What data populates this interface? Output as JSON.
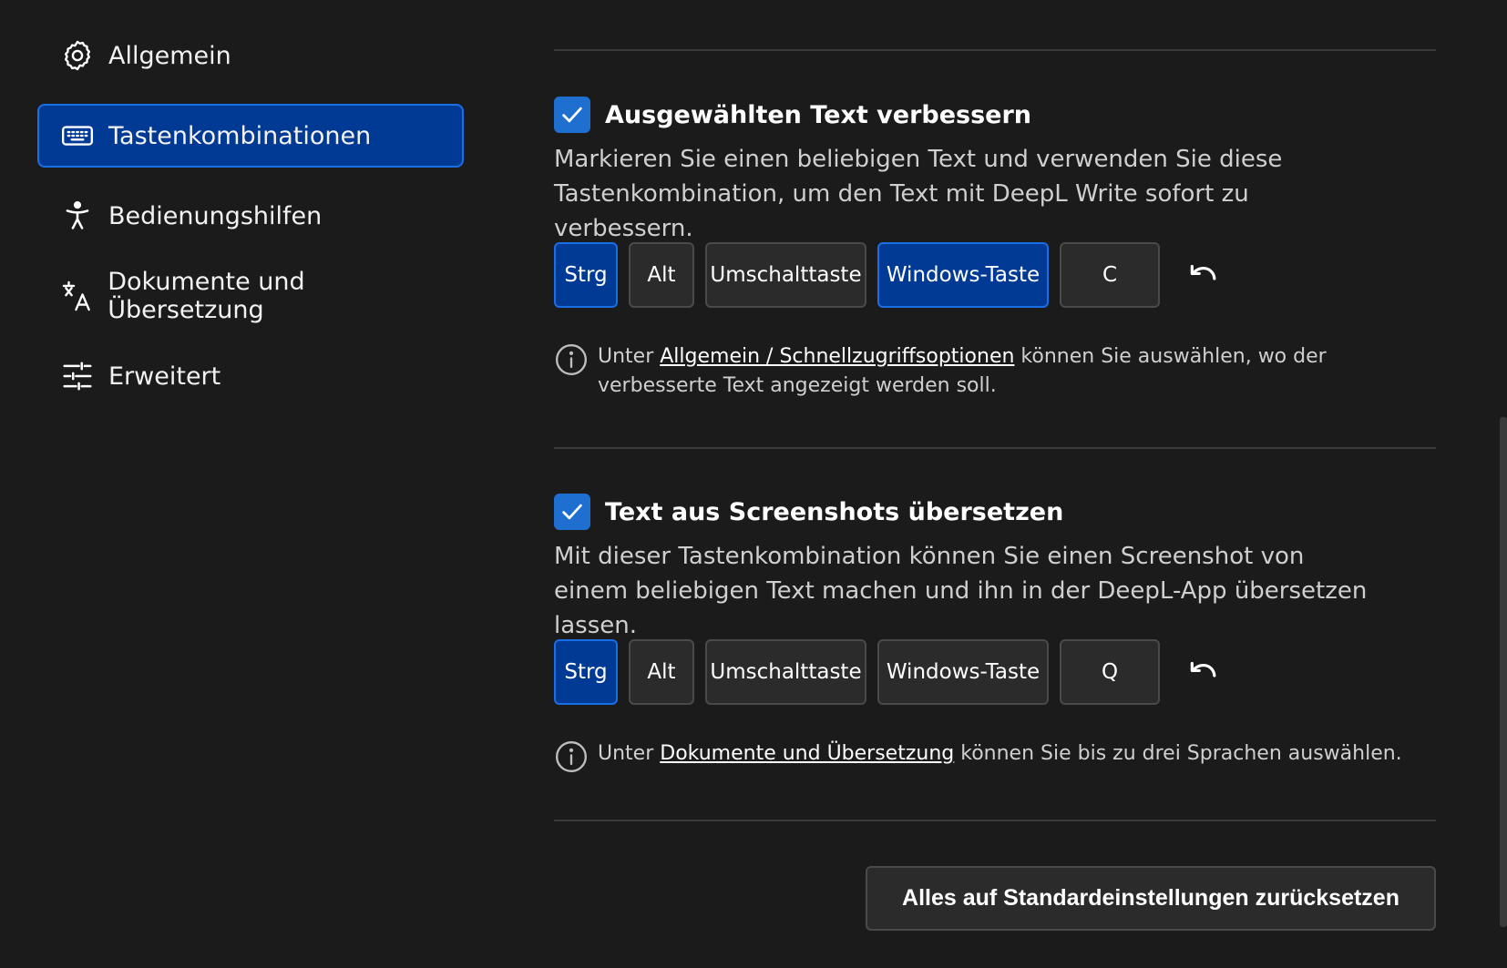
{
  "sidebar": {
    "items": [
      {
        "label": "Allgemein",
        "icon": "gear-icon",
        "active": false
      },
      {
        "label": "Tastenkombinationen",
        "icon": "keyboard-icon",
        "active": true
      },
      {
        "label": "Bedienungshilfen",
        "icon": "accessibility-icon",
        "active": false
      },
      {
        "label": "Dokumente und Übersetzung",
        "icon": "translate-icon",
        "active": false
      },
      {
        "label": "Erweitert",
        "icon": "sliders-icon",
        "active": false
      }
    ]
  },
  "sections": [
    {
      "checked": true,
      "title": "Ausgewählten Text verbessern",
      "description": "Markieren Sie einen beliebigen Text und verwenden Sie diese Tastenkombination, um den Text mit DeepL Write sofort zu verbessern.",
      "keys": [
        {
          "label": "Strg",
          "active": true
        },
        {
          "label": "Alt",
          "active": false
        },
        {
          "label": "Umschalttaste",
          "active": false
        },
        {
          "label": "Windows-Taste",
          "active": true
        },
        {
          "label": "C",
          "active": false
        }
      ],
      "info": {
        "prefix": "Unter ",
        "link": "Allgemein / Schnellzugriffsoptionen",
        "suffix": " können Sie auswählen, wo der verbesserte Text angezeigt werden soll."
      }
    },
    {
      "checked": true,
      "title": "Text aus Screenshots übersetzen",
      "description": "Mit dieser Tastenkombination können Sie einen Screenshot von einem beliebigen Text machen und ihn in der DeepL-App übersetzen lassen.",
      "keys": [
        {
          "label": "Strg",
          "active": true
        },
        {
          "label": "Alt",
          "active": false
        },
        {
          "label": "Umschalttaste",
          "active": false
        },
        {
          "label": "Windows-Taste",
          "active": false
        },
        {
          "label": "Q",
          "active": false
        }
      ],
      "info": {
        "prefix": "Unter ",
        "link": "Dokumente und Übersetzung",
        "suffix": " können Sie bis zu drei Sprachen auswählen."
      }
    }
  ],
  "reset_all_label": "Alles auf Standardeinstellungen zurücksetzen",
  "colors": {
    "background": "#1b1b1b",
    "accent_active": "#003a94",
    "accent_border": "#1a6ee6",
    "checkbox": "#1f6fd1",
    "key_background": "#2b2b2b"
  }
}
